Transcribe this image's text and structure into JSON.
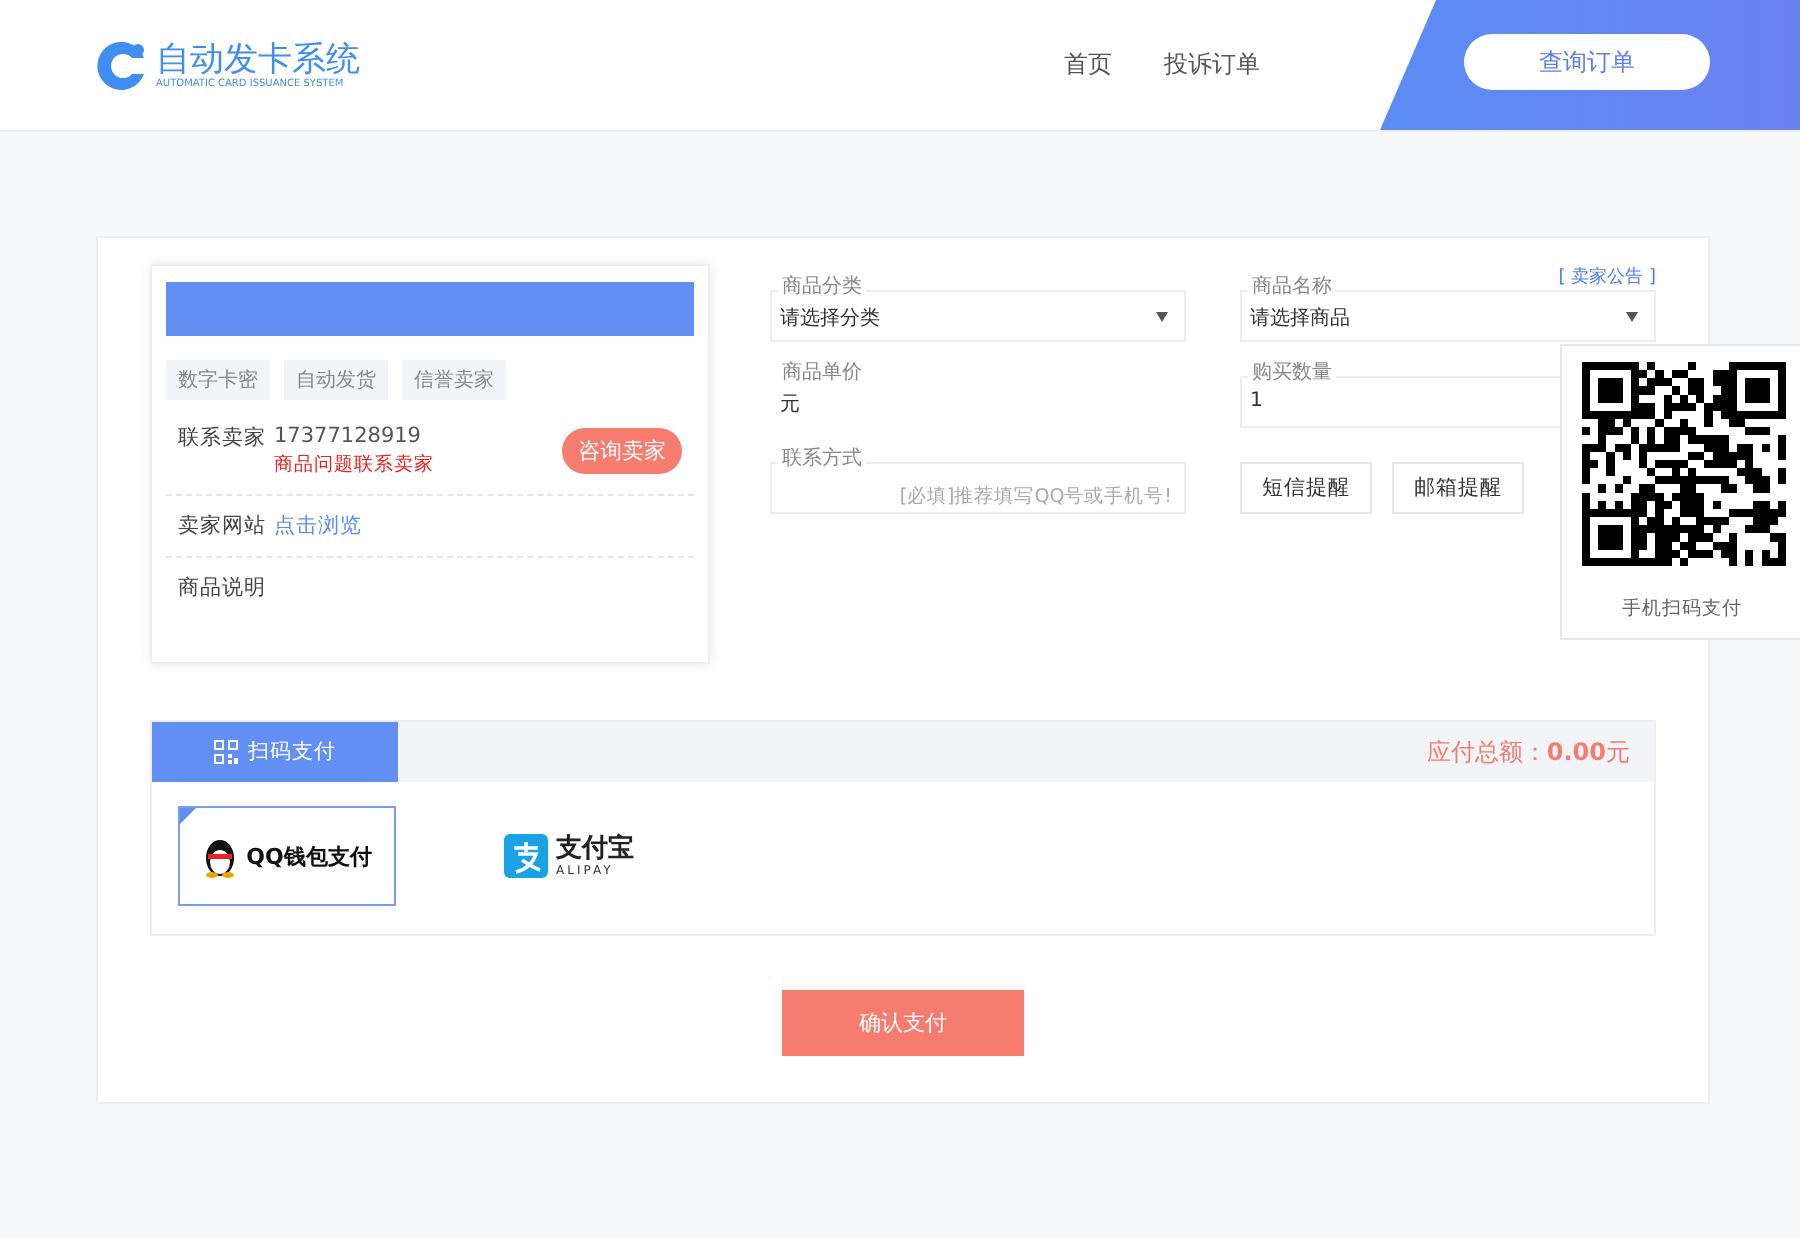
{
  "header": {
    "logo_title": "自动发卡系统",
    "logo_subtitle": "AUTOMATIC CARD ISSUANCE SYSTEM",
    "nav": [
      {
        "label": "首页"
      },
      {
        "label": "投诉订单"
      }
    ],
    "query_button": "查询订单"
  },
  "seller_card": {
    "tags": [
      "数字卡密",
      "自动发货",
      "信誉卖家"
    ],
    "contact_label": "联系卖家",
    "phone": "17377128919",
    "contact_note": "商品问题联系卖家",
    "consult_button": "咨询卖家",
    "website_label": "卖家网站",
    "website_link": "点击浏览",
    "description_label": "商品说明"
  },
  "form": {
    "notice_link": "[ 卖家公告 ]",
    "category": {
      "label": "商品分类",
      "value": "请选择分类"
    },
    "product": {
      "label": "商品名称",
      "value": "请选择商品"
    },
    "price": {
      "label": "商品单价",
      "value": "元"
    },
    "quantity": {
      "label": "购买数量",
      "value": "1"
    },
    "contact": {
      "label": "联系方式",
      "placeholder": "[必填]推荐填写QQ号或手机号!"
    },
    "buttons": [
      "短信提醒",
      "邮箱提醒"
    ]
  },
  "qr_popup": {
    "caption": "手机扫码支付"
  },
  "payment": {
    "tab": "扫码支付",
    "total_label": "应付总额：",
    "total_value": "0.00",
    "total_unit": "元",
    "methods": [
      {
        "kind": "qq",
        "label": "QQ钱包支付",
        "selected": true
      },
      {
        "kind": "alipay",
        "label": "支付宝",
        "sublabel": "ALIPAY",
        "selected": false
      }
    ]
  },
  "confirm_button": "确认支付"
}
